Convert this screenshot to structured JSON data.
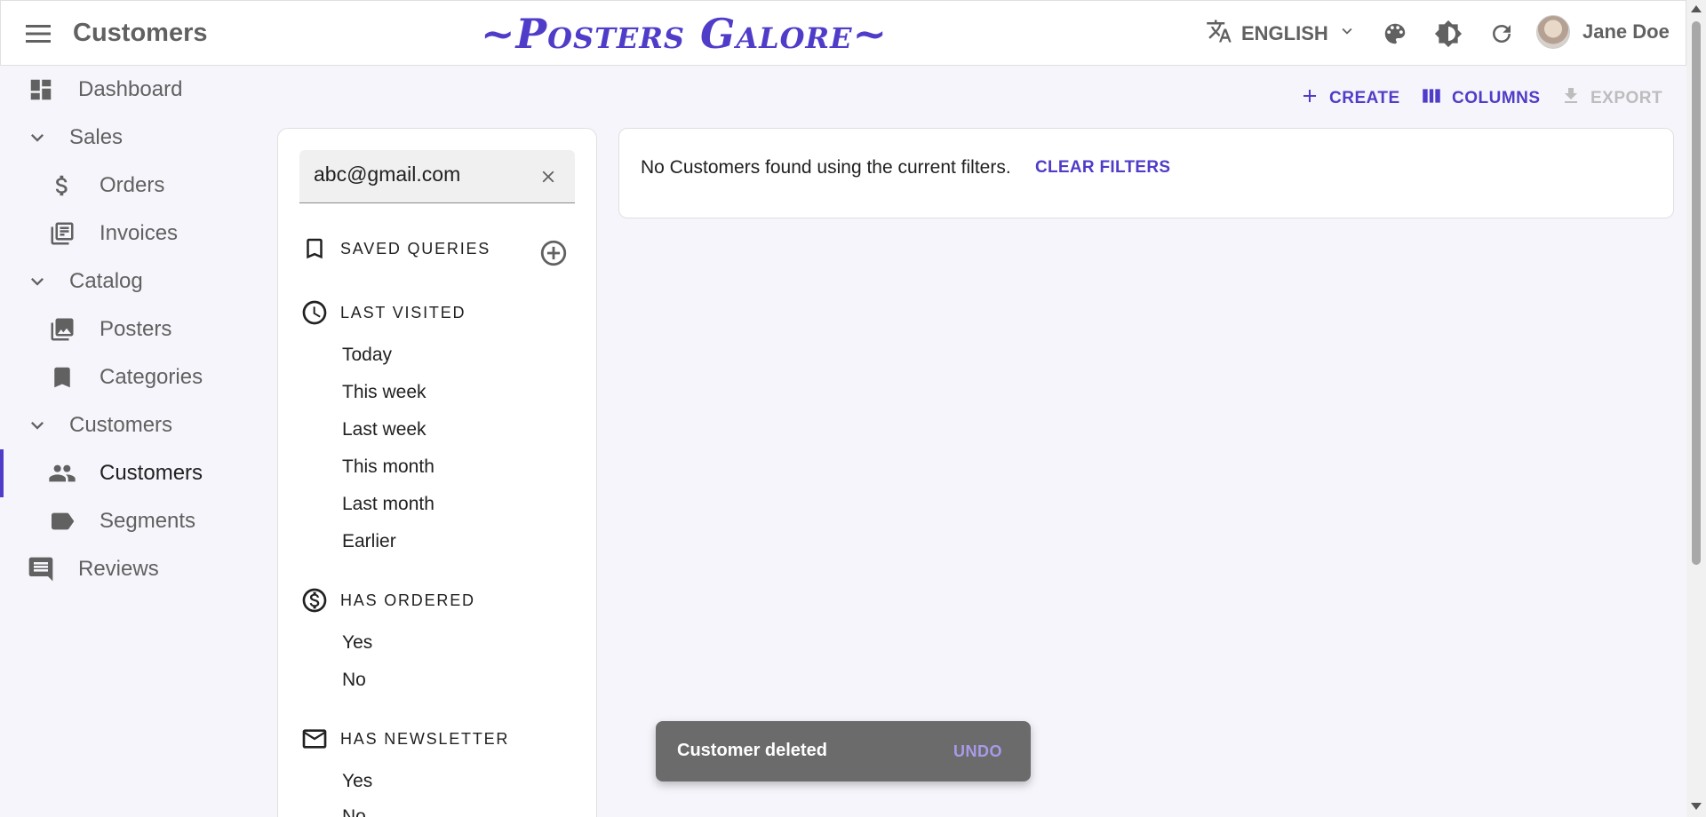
{
  "appbar": {
    "page_title": "Customers",
    "brand": "~Posters Galore~",
    "language": "ENGLISH",
    "user_name": "Jane Doe"
  },
  "sidebar": {
    "items": [
      {
        "label": "Dashboard",
        "icon": "dashboard-icon",
        "kind": "top"
      },
      {
        "label": "Sales",
        "icon": "chevron-down-icon",
        "kind": "group"
      },
      {
        "label": "Orders",
        "icon": "dollar-icon",
        "kind": "sub"
      },
      {
        "label": "Invoices",
        "icon": "library-books-icon",
        "kind": "sub"
      },
      {
        "label": "Catalog",
        "icon": "chevron-down-icon",
        "kind": "group"
      },
      {
        "label": "Posters",
        "icon": "collections-icon",
        "kind": "sub"
      },
      {
        "label": "Categories",
        "icon": "bookmark-icon",
        "kind": "sub"
      },
      {
        "label": "Customers",
        "icon": "chevron-down-icon",
        "kind": "group"
      },
      {
        "label": "Customers",
        "icon": "people-icon",
        "kind": "sub",
        "active": true
      },
      {
        "label": "Segments",
        "icon": "label-icon",
        "kind": "sub"
      },
      {
        "label": "Reviews",
        "icon": "comment-icon",
        "kind": "top"
      }
    ]
  },
  "toolbar": {
    "create_label": "CREATE",
    "columns_label": "COLUMNS",
    "export_label": "EXPORT"
  },
  "filters": {
    "search_value": "abc@gmail.com",
    "saved_queries_label": "SAVED QUERIES",
    "last_visited": {
      "label": "LAST VISITED",
      "options": [
        "Today",
        "This week",
        "Last week",
        "This month",
        "Last month",
        "Earlier"
      ]
    },
    "has_ordered": {
      "label": "HAS ORDERED",
      "options": [
        "Yes",
        "No"
      ]
    },
    "has_newsletter": {
      "label": "HAS NEWSLETTER",
      "options": [
        "Yes",
        "No"
      ]
    }
  },
  "main": {
    "empty_message": "No Customers found using the current filters.",
    "clear_filters_label": "CLEAR FILTERS"
  },
  "snackbar": {
    "message": "Customer deleted",
    "action": "UNDO"
  },
  "colors": {
    "primary": "#4f3cc9",
    "background": "#f5f5fb",
    "snackbar": "#6b6b6b"
  }
}
